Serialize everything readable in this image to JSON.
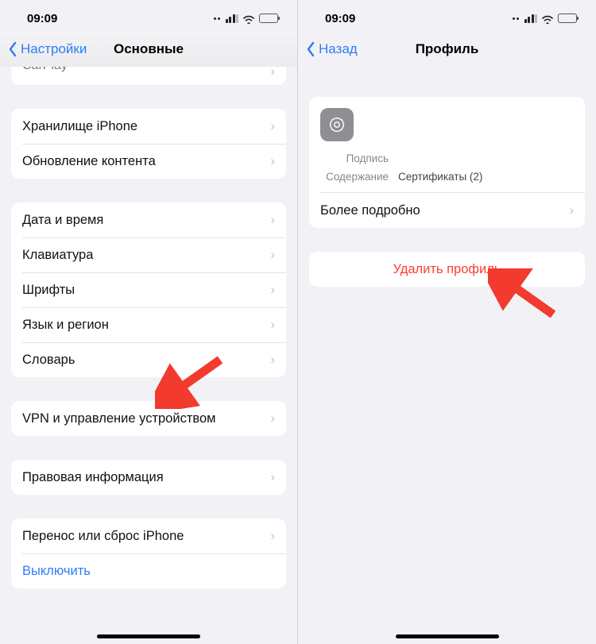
{
  "status": {
    "time": "09:09"
  },
  "left": {
    "back": "Настройки",
    "title": "Основные",
    "peek": "CarPlay",
    "group1": [
      "Хранилище iPhone",
      "Обновление контента"
    ],
    "group2": [
      "Дата и время",
      "Клавиатура",
      "Шрифты",
      "Язык и регион",
      "Словарь"
    ],
    "group3": [
      "VPN и управление устройством"
    ],
    "group4": [
      "Правовая информация"
    ],
    "group5_row": "Перенос или сброс iPhone",
    "group5_shutdown": "Выключить"
  },
  "right": {
    "back": "Назад",
    "title": "Профиль",
    "signature_label": "Подпись",
    "content_label": "Содержание",
    "content_value": "Сертификаты (2)",
    "more": "Более подробно",
    "delete": "Удалить профиль"
  }
}
